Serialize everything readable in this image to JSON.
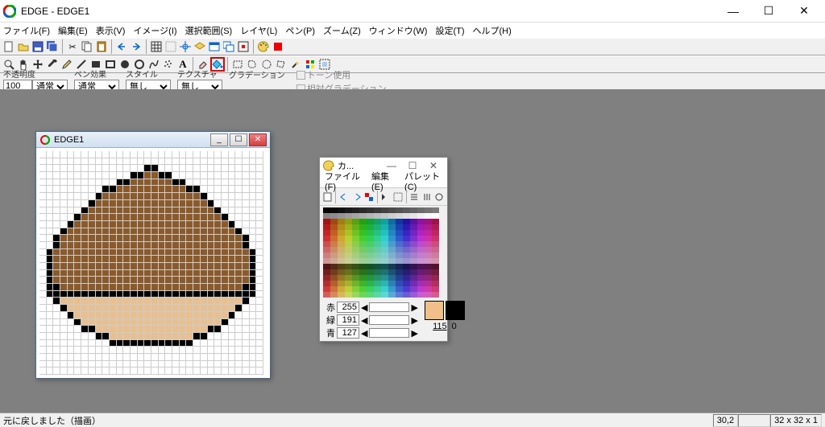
{
  "app": {
    "title": "EDGE - EDGE1"
  },
  "window_controls": {
    "min": "—",
    "max": "☐",
    "close": "✕"
  },
  "menu": {
    "file": "ファイル(F)",
    "edit": "編集(E)",
    "view": "表示(V)",
    "image": "イメージ(I)",
    "select": "選択範囲(S)",
    "layer": "レイヤ(L)",
    "pen": "ペン(P)",
    "zoom": "ズーム(Z)",
    "window": "ウィンドウ(W)",
    "settings": "設定(T)",
    "help": "ヘルプ(H)"
  },
  "options": {
    "opacity_label": "不透明度",
    "opacity_value": "100",
    "opacity_mode": "通常",
    "pen_effect_label": "ペン効果",
    "pen_effect_value": "通常",
    "style_label": "スタイル",
    "style_value": "無し",
    "texture_label": "テクスチャ",
    "texture_value": "無し",
    "gradient_label": "グラデーション",
    "tone_use": "トーン使用",
    "relative_gradient": "相対グラデーション"
  },
  "child": {
    "title": "EDGE1",
    "controls": {
      "min": "_",
      "max": "☐",
      "close": "✕"
    },
    "canvas": {
      "cols": 32,
      "rows": 32
    }
  },
  "palette": {
    "title": "カ...",
    "controls": {
      "min": "—",
      "max": "☐",
      "close": "✕"
    },
    "menu": {
      "file": "ファイル(F)",
      "edit": "編集(E)",
      "pal": "パレット(C)"
    },
    "rgb": {
      "r_label": "赤",
      "g_label": "緑",
      "b_label": "青",
      "r": "255",
      "g": "191",
      "b": "127"
    },
    "index": "115",
    "index2": "0",
    "fg_color": "#f0c088",
    "bg_color": "#000000"
  },
  "status": {
    "msg": "元に戻しました（描画）",
    "coords": "30,2",
    "size": "32 x 32 x 1"
  },
  "chart_data": {
    "type": "pixel-art",
    "grid": "32x32",
    "palette_used": {
      "outline": "#000000",
      "cap": "#8b5a2b",
      "body": "#e8c090",
      "bg": "#ffffff"
    },
    "shape_rows": [
      {
        "y": 2,
        "outline": [
          15,
          16
        ]
      },
      {
        "y": 3,
        "outline": [
          13,
          14,
          17,
          18
        ],
        "cap": [
          15,
          16
        ]
      },
      {
        "y": 4,
        "outline": [
          11,
          12,
          19,
          20
        ],
        "cap": [
          13,
          14,
          15,
          16,
          17,
          18
        ]
      },
      {
        "y": 5,
        "outline": [
          9,
          10,
          21,
          22
        ],
        "cap": [
          11,
          12,
          13,
          14,
          15,
          16,
          17,
          18,
          19,
          20
        ]
      },
      {
        "y": 6,
        "outline": [
          8,
          23
        ],
        "cap_range": [
          9,
          22
        ]
      },
      {
        "y": 7,
        "outline": [
          7,
          24
        ],
        "cap_range": [
          8,
          23
        ]
      },
      {
        "y": 8,
        "outline": [
          6,
          25
        ],
        "cap_range": [
          7,
          24
        ]
      },
      {
        "y": 9,
        "outline": [
          5,
          26
        ],
        "cap_range": [
          6,
          25
        ]
      },
      {
        "y": 10,
        "outline": [
          4,
          27
        ],
        "cap_range": [
          5,
          26
        ]
      },
      {
        "y": 11,
        "outline": [
          3,
          28
        ],
        "cap_range": [
          4,
          27
        ]
      },
      {
        "y": 12,
        "outline": [
          2,
          29
        ],
        "cap_range": [
          3,
          28
        ]
      },
      {
        "y": 13,
        "outline": [
          2,
          29
        ],
        "cap_range": [
          3,
          28
        ]
      },
      {
        "y": 14,
        "outline": [
          1,
          30
        ],
        "cap_range": [
          2,
          29
        ]
      },
      {
        "y": 15,
        "outline": [
          1,
          30
        ],
        "cap_range": [
          2,
          29
        ]
      },
      {
        "y": 16,
        "outline": [
          1,
          30
        ],
        "cap_range": [
          2,
          29
        ]
      },
      {
        "y": 17,
        "outline": [
          1,
          30
        ],
        "cap_range": [
          2,
          29
        ]
      },
      {
        "y": 18,
        "outline": [
          1,
          30
        ],
        "cap_range": [
          2,
          29
        ]
      },
      {
        "y": 19,
        "outline": [
          1,
          2,
          29,
          30
        ],
        "cap_range": [
          3,
          28
        ]
      },
      {
        "y": 20,
        "outline_range": [
          1,
          30
        ]
      },
      {
        "y": 21,
        "outline": [
          2,
          29
        ],
        "body_range": [
          3,
          28
        ]
      },
      {
        "y": 22,
        "outline": [
          3,
          28
        ],
        "body_range": [
          4,
          27
        ]
      },
      {
        "y": 23,
        "outline": [
          4,
          27
        ],
        "body_range": [
          5,
          26
        ]
      },
      {
        "y": 24,
        "outline": [
          5,
          26
        ],
        "body_range": [
          6,
          25
        ]
      },
      {
        "y": 25,
        "outline": [
          6,
          7,
          24,
          25
        ],
        "body_range": [
          8,
          23
        ]
      },
      {
        "y": 26,
        "outline": [
          8,
          9,
          22,
          23
        ],
        "body_range": [
          10,
          21
        ]
      },
      {
        "y": 27,
        "outline_range": [
          10,
          21
        ]
      }
    ]
  }
}
